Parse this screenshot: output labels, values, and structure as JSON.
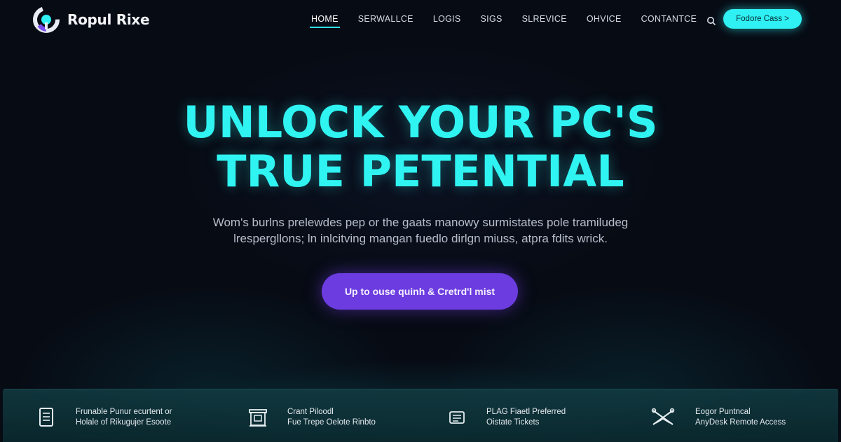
{
  "brand": {
    "name": "Ropul Rixe"
  },
  "nav": {
    "items": [
      {
        "label": "HOME",
        "active": true
      },
      {
        "label": "SERWALLCE"
      },
      {
        "label": "LOGIS"
      },
      {
        "label": "SIGS"
      },
      {
        "label": "SLREVICE"
      },
      {
        "label": "OHVICE"
      },
      {
        "label": "CONTANTCE"
      }
    ],
    "search_icon": "search-icon",
    "cta_label": "Fodore Cass >"
  },
  "hero": {
    "title_line1": "UNLOCK YOUR PC'S",
    "title_line2": "TRUE PETENTIAL",
    "subtitle_line1": "Wom's burlns prelewdes pep or the gaats manowy surmistates pole tramiludeg",
    "subtitle_line2": "lrespergllons; ln inlcitving mangan fuedlo dirlgn miuss, atpra fdits wrick.",
    "cta_label": "Up to ouse quinh & Cretrd'l mist"
  },
  "features": [
    {
      "icon": "document-icon",
      "line1": "Frunable Punur ecurtent or",
      "line2": "Holale of Rikugujer Esoote"
    },
    {
      "icon": "monitor-icon",
      "line1": "Crant Piloodl",
      "line2": "Fue Trepe Oelote Rinbto"
    },
    {
      "icon": "ticket-icon",
      "line1": "PLAG Fiaetl Preferred",
      "line2": "Oistate Tickets"
    },
    {
      "icon": "remote-tools-icon",
      "line1": "Eogor Puntncal",
      "line2": "AnyDesk Remote Access"
    }
  ],
  "colors": {
    "accent_cyan": "#2ff4f2",
    "accent_purple": "#6c3ce0",
    "background": "#070b14"
  }
}
